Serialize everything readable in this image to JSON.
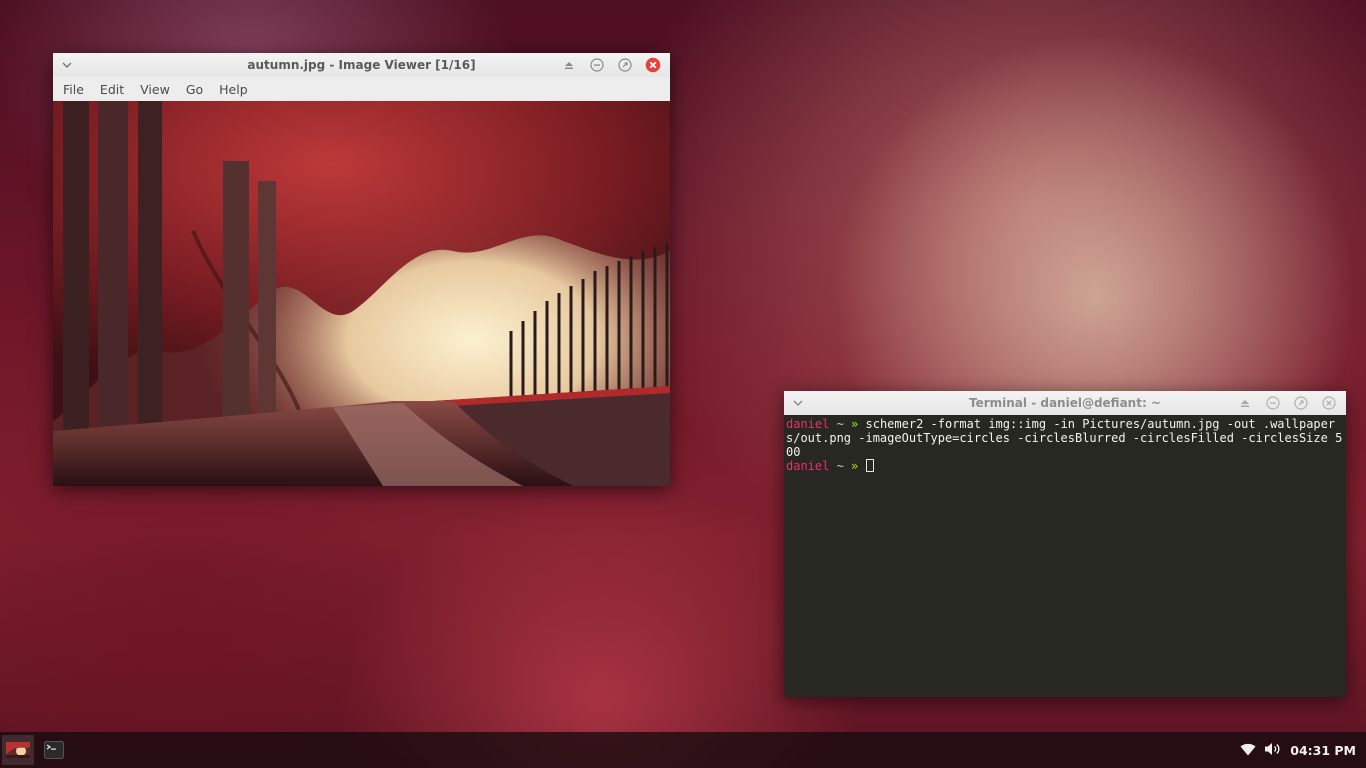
{
  "desktop": {
    "colors": {
      "accent": "#7a1c2e",
      "taskbar": "#160c0e"
    }
  },
  "viewer": {
    "title": "autumn.jpg - Image Viewer [1/16]",
    "menus": [
      "File",
      "Edit",
      "View",
      "Go",
      "Help"
    ],
    "image_alt_icon": "photo-icon",
    "buttons": {
      "menu_icon": "chevron-down-icon",
      "shade_icon": "eject-icon",
      "minimize_icon": "minimize-icon",
      "maximize_icon": "maximize-icon",
      "close_icon": "close-icon"
    },
    "colors": {
      "close": "#e8403a"
    }
  },
  "terminal": {
    "title": "Terminal - daniel@defiant: ~",
    "lines": [
      {
        "user": "daniel",
        "sep": " ~ ",
        "arrow": "»",
        "command": " schemer2 -format img::img -in Pictures/autumn.jpg -out .wallpapers/out.png -imageOutType=circles -circlesBlurred -circlesFilled -circlesSize 500"
      },
      {
        "user": "daniel",
        "sep": " ~ ",
        "arrow": "»",
        "command": " "
      }
    ],
    "colors": {
      "background": "#272822",
      "user": "#ea2d73",
      "arrow": "#a7e22e"
    }
  },
  "taskbar": {
    "tasks": [
      {
        "name": "image-viewer-task",
        "icon": "photo-thumbnail-icon"
      },
      {
        "name": "terminal-task",
        "icon": "terminal-icon"
      }
    ],
    "tray": {
      "wifi_icon": "wifi-icon",
      "volume_icon": "volume-icon",
      "clock": "04:31 PM"
    }
  }
}
